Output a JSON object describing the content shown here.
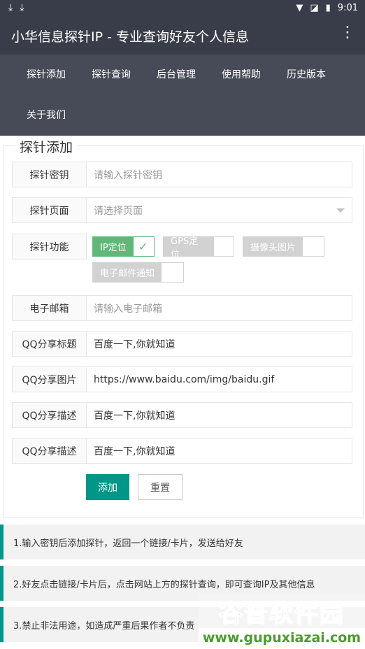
{
  "status_bar": {
    "left_icons": [
      "download-icon",
      "download-icon"
    ],
    "time": "9:01"
  },
  "app_bar": {
    "title": "小华信息探针IP - 专业查询好友个人信息"
  },
  "nav": {
    "items": [
      "探针添加",
      "探针查询",
      "后台管理",
      "使用帮助",
      "历史版本",
      "关于我们"
    ]
  },
  "form": {
    "legend": "探针添加",
    "key": {
      "label": "探针密钥",
      "placeholder": "请输入探针密钥"
    },
    "page": {
      "label": "探针页面",
      "placeholder": "请选择页面"
    },
    "features": {
      "label": "探针功能",
      "options": [
        {
          "label": "IP定位",
          "checked": true
        },
        {
          "label": "GPS定位",
          "checked": false
        },
        {
          "label": "摄像头图片",
          "checked": false
        },
        {
          "label": "电子邮件通知",
          "checked": false
        }
      ]
    },
    "email": {
      "label": "电子邮箱",
      "placeholder": "请输入电子邮箱"
    },
    "qq_title": {
      "label": "QQ分享标题",
      "value": "百度一下,你就知道"
    },
    "qq_image": {
      "label": "QQ分享图片",
      "value": "https://www.baidu.com/img/baidu.gif"
    },
    "qq_desc1": {
      "label": "QQ分享描述",
      "value": "百度一下,你就知道"
    },
    "qq_desc2": {
      "label": "QQ分享描述",
      "value": "百度一下,你就知道"
    },
    "submit_label": "添加",
    "reset_label": "重置"
  },
  "tips": [
    "1.输入密钥后添加探针，返回一个链接/卡片，发送给好友",
    "2.好友点击链接/卡片后，点击网站上方的探针查询，即可查询IP及其他信息",
    "3.禁止非法用途，如造成严重后果作者不负责"
  ],
  "watermark": {
    "name": "谷普软件园",
    "url": "www.gupuxiazai.com"
  },
  "colors": {
    "header": "#393d49",
    "nav": "#474b58",
    "primary": "#009688",
    "checked": "#5fb878"
  }
}
